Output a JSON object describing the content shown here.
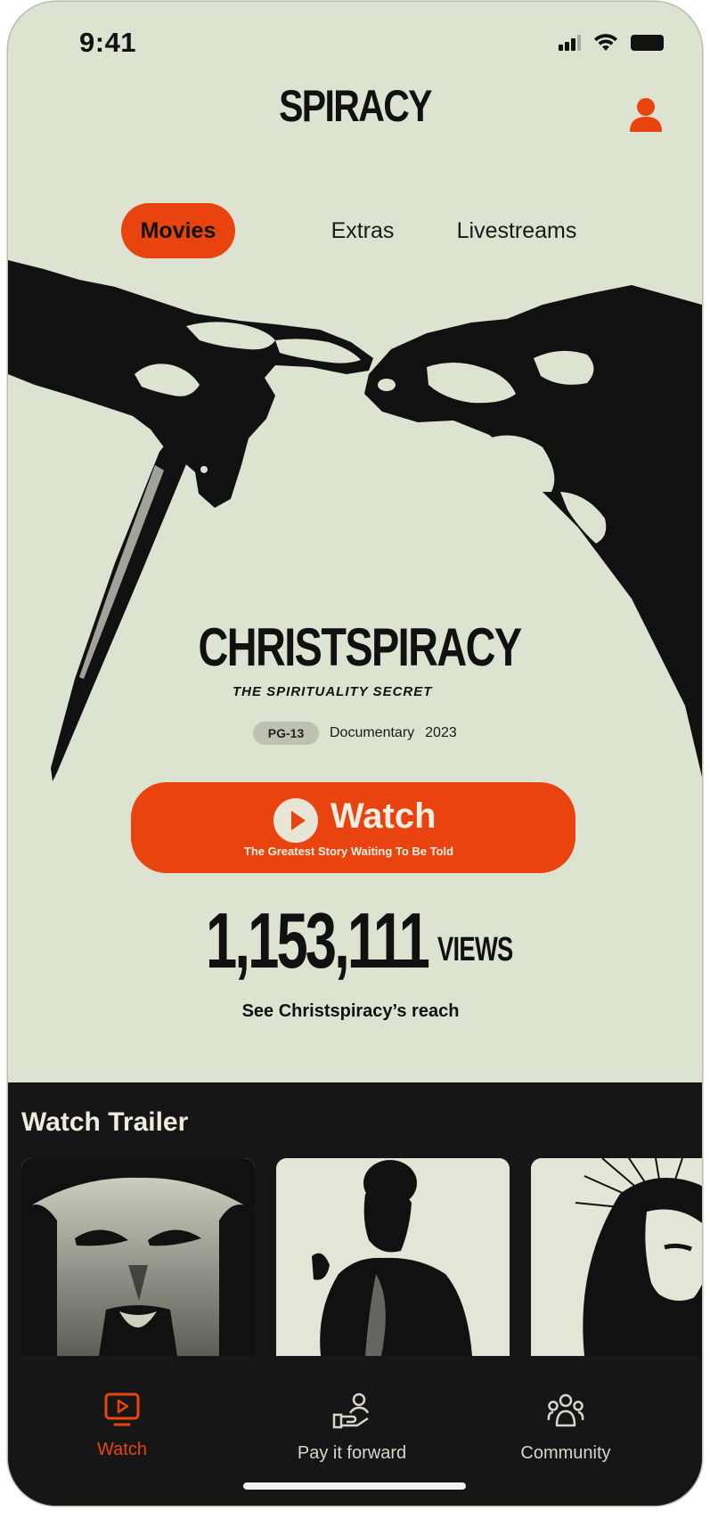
{
  "status_bar": {
    "time": "9:41"
  },
  "header": {
    "brand": "SPIRACY"
  },
  "tabs": [
    {
      "label": "Movies",
      "active": true
    },
    {
      "label": "Extras",
      "active": false
    },
    {
      "label": "Livestreams",
      "active": false
    }
  ],
  "hero": {
    "title": "CHRISTSPIRACY",
    "subtitle": "THE SPIRITUALITY SECRET",
    "rating": "PG-13",
    "genre": "Documentary",
    "year": "2023",
    "watch_label": "Watch",
    "watch_sublabel": "The Greatest Story Waiting To Be Told",
    "views_count": "1,153,111",
    "views_label": "VIEWS",
    "reach_link": "See Christspiracy’s reach"
  },
  "trailers": {
    "heading": "Watch Trailer"
  },
  "tab_bar": [
    {
      "label": "Watch",
      "icon": "play-screen-icon",
      "active": true
    },
    {
      "label": "Pay it forward",
      "icon": "hand-person-icon",
      "active": false
    },
    {
      "label": "Community",
      "icon": "community-icon",
      "active": false
    }
  ],
  "colors": {
    "accent": "#e9440f",
    "background": "#dde3d1",
    "dark": "#161616"
  }
}
